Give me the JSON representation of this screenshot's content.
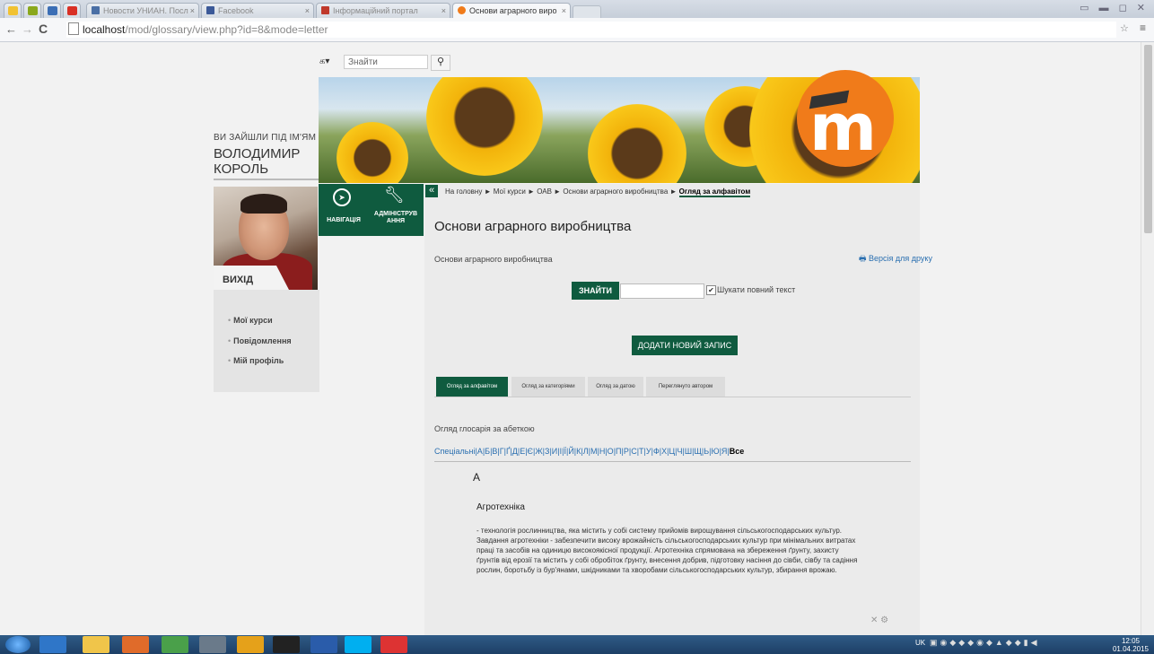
{
  "browser": {
    "tabs": [
      {
        "label": "Новости УНИАН. Посл",
        "close": "×"
      },
      {
        "label": "Facebook",
        "close": "×"
      },
      {
        "label": "Інформаційний портал",
        "close": "×"
      },
      {
        "label": "Основи аграрного виро",
        "close": "×"
      }
    ],
    "url_host": "localhost",
    "url_path": "/mod/glossary/view.php?id=8&mode=letter"
  },
  "header": {
    "search_placeholder": "Знайти",
    "lang_icon": "translate-icon"
  },
  "user": {
    "logged_in_as": "ВИ ЗАЙШЛИ ПІД ІМ'ЯМ",
    "name": "ВОЛОДИМИР КОРОЛЬ",
    "logout": "ВИХІД"
  },
  "left_menu": {
    "items": [
      {
        "label": "Мої курси"
      },
      {
        "label": "Повідомлення"
      },
      {
        "label": "Мій профіль"
      }
    ]
  },
  "nav_blocks": {
    "navigation": "НАВІГАЦІЯ",
    "admin_line1": "АДМІНІСТРУВ",
    "admin_line2": "АННЯ"
  },
  "breadcrumb": {
    "collapse": "«",
    "items": [
      "На головну",
      "Мої курси",
      "ОАВ",
      "Основи аграрного виробництва"
    ],
    "current": "Огляд за алфавітом",
    "sep": "►"
  },
  "main": {
    "heading": "Основи аграрного виробництва",
    "course_name": "Основи аграрного виробництва",
    "print_link": "Версія для друку",
    "search_button": "ЗНАЙТИ",
    "fulltext_label": "Шукати повний текст",
    "add_entry": "ДОДАТИ НОВИЙ ЗАПИС",
    "tabs": [
      {
        "label": "Огляд за алфавітом"
      },
      {
        "label": "Огляд за категоріями"
      },
      {
        "label": "Огляд за датою"
      },
      {
        "label": "Переглянуто автором"
      }
    ],
    "browse_label": "Огляд глосарія за абеткою",
    "alphabet_special": "Спеціальні",
    "alphabet": [
      "А",
      "Б",
      "В",
      "Г",
      "Ґ",
      "Д",
      "Е",
      "Є",
      "Ж",
      "З",
      "И",
      "І",
      "Ї",
      "Й",
      "К",
      "Л",
      "М",
      "Н",
      "О",
      "П",
      "Р",
      "С",
      "Т",
      "У",
      "Ф",
      "Х",
      "Ц",
      "Ч",
      "Ш",
      "Щ",
      "Ь",
      "Ю",
      "Я"
    ],
    "alphabet_all": "Все",
    "letter_heading": "А",
    "entry": {
      "term": "Агротехніка",
      "definition": "- технологія рослинництва, яка містить у собі систему прийомів вирощування сільськогосподарських культур. Завдання агротехніки - забезпечити високу врожайність сільськогосподарських культур при мінімальних витратах праці та засобів на одиницю високоякісної продукції. Агротехніка спрямована на збереження ґрунту, захисту ґрунтів від ерозії та містить у собі обробіток ґрунту, внесення добрив, підготовку насіння до сівби, сівбу та садіння рослин, боротьбу із бур'янами, шкідниками та хворобами сільськогосподарських культур, збирання врожаю."
    }
  },
  "taskbar": {
    "lang": "UK",
    "time": "12:05",
    "date": "01.04.2015"
  },
  "colors": {
    "brand_green": "#0f5b3f",
    "link_blue": "#2a6fb0",
    "moodle_orange": "#f07b1a"
  }
}
